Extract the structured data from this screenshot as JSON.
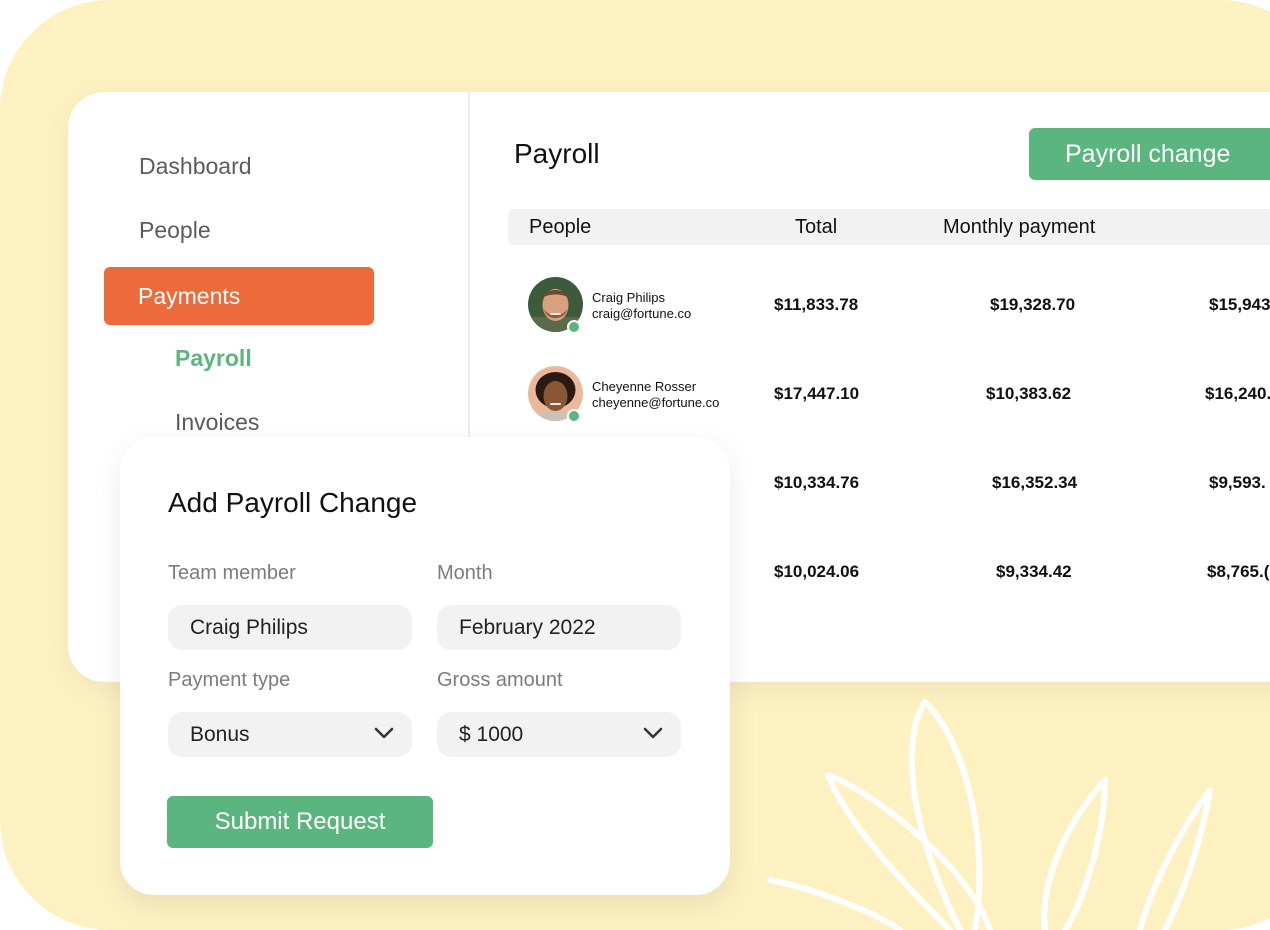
{
  "colors": {
    "background": "#fdf1c2",
    "accent_orange": "#ec6a3c",
    "accent_green": "#5bb57f"
  },
  "sidebar": {
    "items": [
      {
        "label": "Dashboard"
      },
      {
        "label": "People"
      },
      {
        "label": "Payments",
        "active": true
      }
    ],
    "sub_items": [
      {
        "label": "Payroll",
        "active": true
      },
      {
        "label": "Invoices"
      }
    ]
  },
  "main": {
    "title": "Payroll",
    "action_label": "Payroll change",
    "table": {
      "headers": [
        "People",
        "Total",
        "Monthly payment"
      ],
      "rows": [
        {
          "name": "Craig Philips",
          "email": "craig@fortune.co",
          "total": "$11,833.78",
          "monthly": "$19,328.70",
          "extra": "$15,943"
        },
        {
          "name": "Cheyenne Rosser",
          "email": "cheyenne@fortune.co",
          "total": "$17,447.10",
          "monthly": "$10,383.62",
          "extra": "$16,240."
        },
        {
          "total": "$10,334.76",
          "monthly": "$16,352.34",
          "extra": "$9,593."
        },
        {
          "total": "$10,024.06",
          "monthly": "$9,334.42",
          "extra": "$8,765.("
        }
      ]
    }
  },
  "modal": {
    "title": "Add Payroll Change",
    "fields": {
      "team_member": {
        "label": "Team member",
        "value": "Craig Philips"
      },
      "month": {
        "label": "Month",
        "value": "February 2022"
      },
      "payment_type": {
        "label": "Payment type",
        "value": "Bonus"
      },
      "gross_amount": {
        "label": "Gross amount",
        "value": "$ 1000"
      }
    },
    "submit_label": "Submit Request"
  }
}
